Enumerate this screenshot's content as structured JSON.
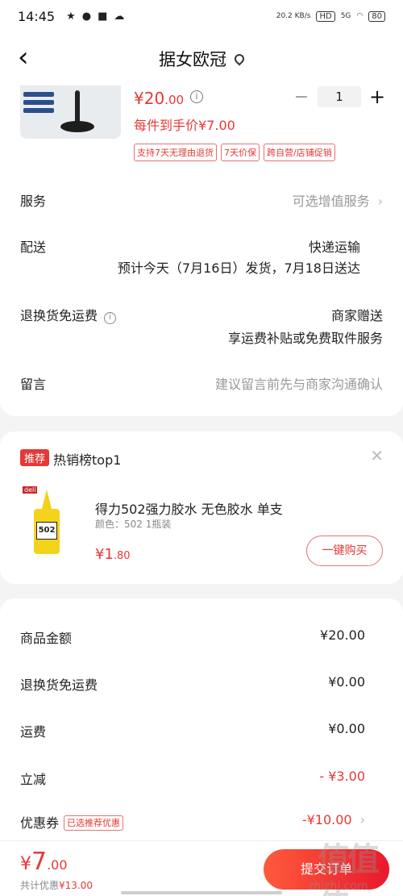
{
  "statusbar": {
    "time": "14:45",
    "net_speed_top": "20.2",
    "net_speed_unit": "KB/s",
    "hd": "HD",
    "signal": "5G",
    "battery": "80"
  },
  "header": {
    "title": "据女欧冠"
  },
  "product": {
    "price_main": "¥20",
    "price_decimal": ".00",
    "per_unit": "每件到手价¥7.00",
    "quantity": "1",
    "badges": [
      "支持7天无理由退货",
      "7天价保",
      "跨自营/店铺促销"
    ]
  },
  "rows": {
    "service_label": "服务",
    "service_value": "可选增值服务",
    "delivery_label": "配送",
    "delivery_method": "快递运输",
    "delivery_eta": "预计今天（7月16日）发货，7月18日送达",
    "return_label": "退换货免运费",
    "return_value": "商家赠送",
    "return_detail": "享运费补贴或免费取件服务",
    "note_label": "留言",
    "note_placeholder": "建议留言前先与商家沟通确认"
  },
  "recommend": {
    "badge": "推荐",
    "title": "热销榜top1",
    "name": "得力502强力胶水 无色胶水 单支",
    "spec": "颜色：502 1瓶装",
    "price_main": "¥1",
    "price_decimal": ".80",
    "buy_label": "一键购买",
    "brand_label": "deli",
    "bottle_label": "502"
  },
  "summary": {
    "rows": [
      {
        "label": "商品金额",
        "value": "¥20.00"
      },
      {
        "label": "退换货免运费",
        "value": "¥0.00"
      },
      {
        "label": "运费",
        "value": "¥0.00"
      },
      {
        "label": "立减",
        "value": "- ¥3.00"
      },
      {
        "label": "优惠券",
        "value": "-¥10.00",
        "tag": "已选推荐优惠"
      }
    ]
  },
  "bottom": {
    "currency": "¥",
    "total_main": "7",
    "total_decimal": ".00",
    "saved_prefix": "共计优惠",
    "saved_value": "¥13.00",
    "submit_label": "提交订单"
  },
  "watermark": {
    "site": "zhizhi.com",
    "logo": "值值值"
  },
  "colors": {
    "accent": "#e53935",
    "muted": "#999999"
  }
}
